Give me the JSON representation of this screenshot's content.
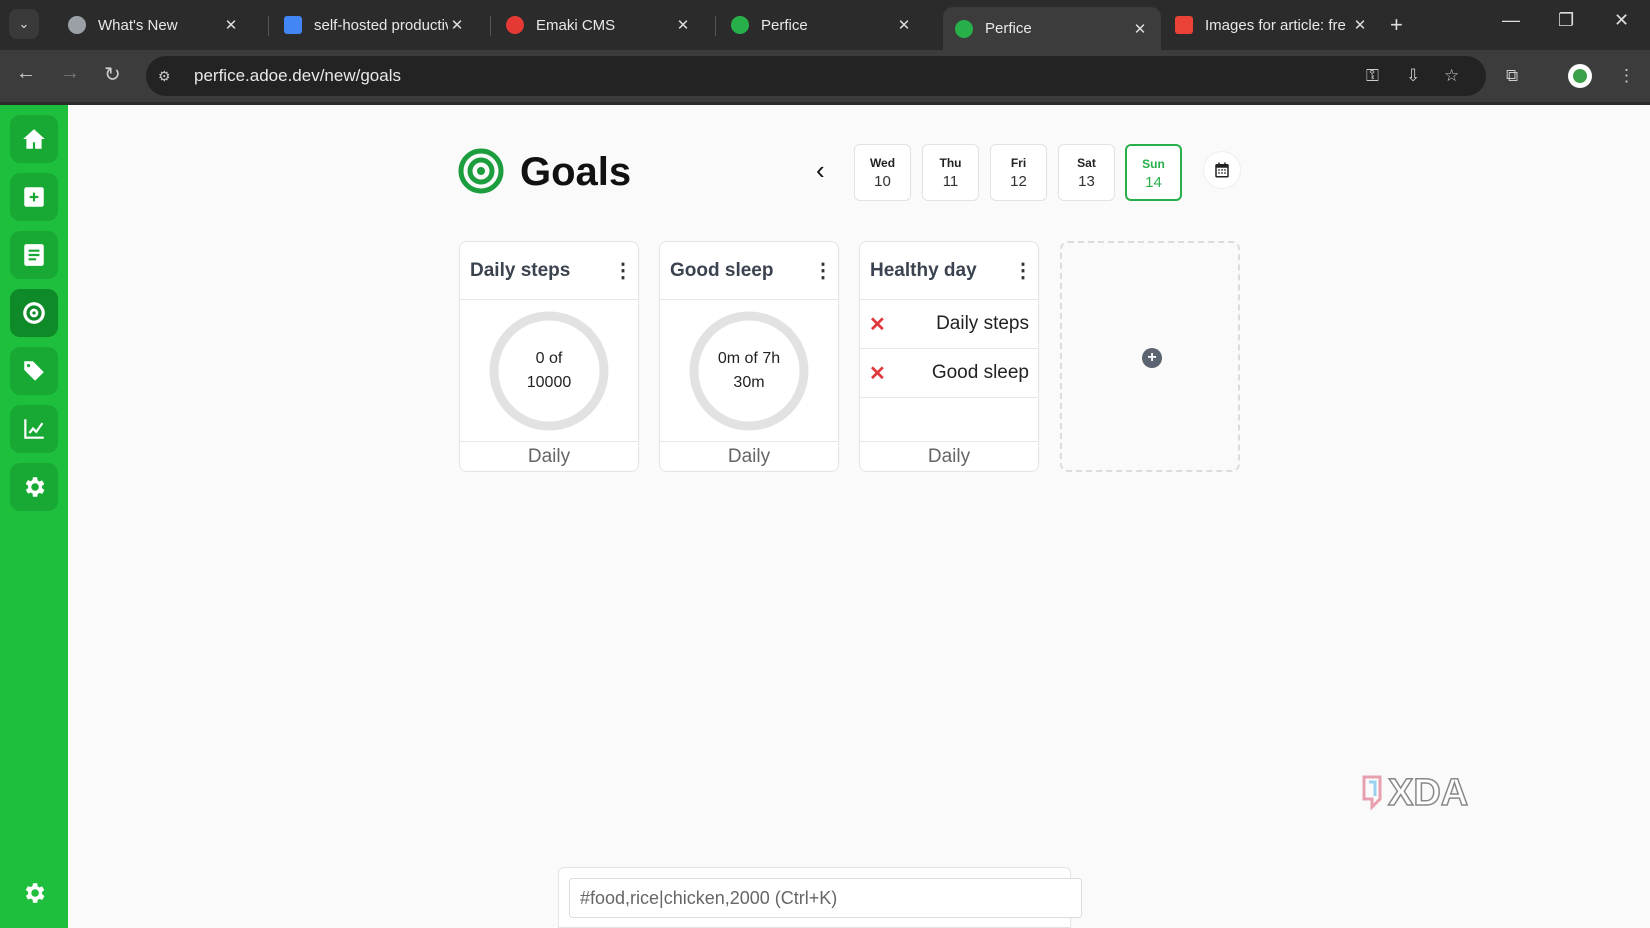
{
  "browser": {
    "tabs": [
      {
        "title": "What's New",
        "favicon": "chrome-icon",
        "color": "#9aa0a6"
      },
      {
        "title": "self-hosted productiv",
        "favicon": "docs-icon",
        "color": "#4285f4"
      },
      {
        "title": "Emaki CMS",
        "favicon": "emaki-icon",
        "color": "#e53935"
      },
      {
        "title": "Perfice",
        "favicon": "perfice-icon",
        "color": "#27b04a"
      },
      {
        "title": "Perfice",
        "favicon": "perfice-icon",
        "color": "#27b04a",
        "active": true
      },
      {
        "title": "Images for article: fre",
        "favicon": "gmail-icon",
        "color": "#ea4335"
      }
    ],
    "url": "perfice.adoe.dev/new/goals"
  },
  "sidebar": {
    "items": [
      "home-icon",
      "add-icon",
      "journal-icon",
      "goals-icon",
      "tags-icon",
      "analytics-icon",
      "settings-icon"
    ],
    "active_index": 3,
    "bottom": "settings-icon"
  },
  "page": {
    "title": "Goals",
    "days": [
      {
        "name": "Wed",
        "date": "10"
      },
      {
        "name": "Thu",
        "date": "11"
      },
      {
        "name": "Fri",
        "date": "12"
      },
      {
        "name": "Sat",
        "date": "13"
      },
      {
        "name": "Sun",
        "date": "14",
        "selected": true
      }
    ],
    "accent": "#27b04a"
  },
  "goals": [
    {
      "name": "Daily steps",
      "progress_line1": "0 of",
      "progress_line2": "10000",
      "progress": 0,
      "period": "Daily"
    },
    {
      "name": "Good sleep",
      "progress_line1": "0m of 7h",
      "progress_line2": "30m",
      "progress": 0,
      "period": "Daily"
    },
    {
      "name": "Healthy day",
      "subgoals": [
        {
          "label": "Daily steps",
          "done": false
        },
        {
          "label": "Good sleep",
          "done": false
        }
      ],
      "period": "Daily"
    }
  ],
  "command": {
    "placeholder": "#food,rice|chicken,2000 (Ctrl+K)"
  },
  "watermark": "XDA"
}
